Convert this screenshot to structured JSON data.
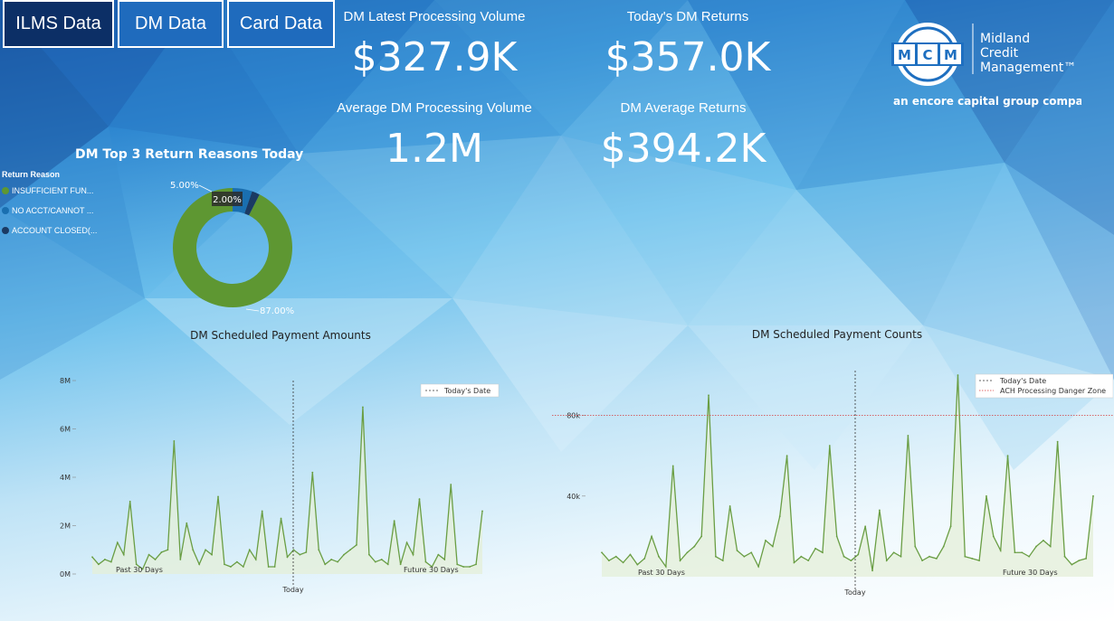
{
  "tabs": [
    {
      "label": "ILMS Data",
      "active": true
    },
    {
      "label": "DM Data",
      "active": false
    },
    {
      "label": "Card Data",
      "active": false
    }
  ],
  "kpis": {
    "latest_volume": {
      "label": "DM Latest Processing Volume",
      "value": "$327.9K"
    },
    "todays_returns": {
      "label": "Today's DM Returns",
      "value": "$357.0K"
    },
    "avg_volume": {
      "label": "Average DM Processing Volume",
      "value": "1.2M"
    },
    "avg_returns": {
      "label": "DM Average Returns",
      "value": "$394.2K"
    }
  },
  "logo": {
    "mark": "MCM",
    "line1": "Midland",
    "line2": "Credit",
    "line3": "Management™",
    "tagline": "an encore capital group company"
  },
  "colors": {
    "insufficient": "#5e9732",
    "no_acct": "#1a6fb0",
    "closed": "#1b3a63",
    "line": "#6a9e44",
    "danger": "#d63a3a"
  },
  "chart_data": [
    {
      "type": "pie",
      "title": "DM Top 3 Return Reasons Today",
      "legend_title": "Return Reason",
      "legend": [
        "INSUFFICIENT FUN...",
        "NO ACCT/CANNOT ...",
        "ACCOUNT CLOSED(..."
      ],
      "values": [
        87.0,
        5.0,
        2.0
      ],
      "labels": [
        "87.00%",
        "5.00%",
        "2.00%"
      ]
    },
    {
      "type": "line",
      "title": "DM Scheduled Payment Amounts",
      "y_ticks": [
        "0M",
        "2M",
        "4M",
        "6M",
        "8M"
      ],
      "ylim": [
        0,
        8
      ],
      "legend": [
        "Today's Date"
      ],
      "x_labels": {
        "past": "Past 30 Days",
        "today": "Today",
        "future": "Future 30 Days"
      },
      "series": [
        {
          "values": [
            0.7,
            0.4,
            0.6,
            0.5,
            1.3,
            0.8,
            3.0,
            0.4,
            0.2,
            0.8,
            0.6,
            0.9,
            1.0,
            5.5,
            0.6,
            2.1,
            1.0,
            0.4,
            1.0,
            0.8,
            3.2,
            0.4,
            0.3,
            0.5,
            0.3,
            1.0,
            0.6,
            2.6,
            0.3,
            0.3,
            2.3,
            0.7,
            1.0,
            0.8,
            0.9,
            4.2,
            1.0,
            0.4,
            0.6,
            0.5,
            0.8,
            1.0,
            1.2,
            6.9,
            0.8,
            0.5,
            0.6,
            0.4,
            2.2,
            0.4,
            1.3,
            0.8,
            3.1,
            0.5,
            0.3,
            0.8,
            0.6,
            3.7,
            0.4,
            0.3,
            0.3,
            0.4,
            2.6
          ]
        }
      ]
    },
    {
      "type": "line",
      "title": "DM Scheduled Payment Counts",
      "y_ticks": [
        "40k",
        "80k"
      ],
      "ylim": [
        0,
        100
      ],
      "legend": [
        "Today's Date",
        "ACH Processing Danger Zone"
      ],
      "danger_level": 80,
      "x_labels": {
        "past": "Past 30 Days",
        "today": "Today",
        "future": "Future 30 Days"
      },
      "series": [
        {
          "values": [
            12,
            8,
            10,
            7,
            11,
            6,
            9,
            20,
            10,
            5,
            55,
            8,
            12,
            15,
            20,
            90,
            10,
            8,
            35,
            13,
            10,
            12,
            5,
            18,
            15,
            30,
            60,
            7,
            10,
            8,
            14,
            12,
            65,
            20,
            10,
            8,
            11,
            25,
            3,
            33,
            8,
            12,
            10,
            70,
            15,
            8,
            10,
            9,
            15,
            25,
            100,
            10,
            9,
            8,
            40,
            20,
            13,
            60,
            12,
            12,
            10,
            15,
            18,
            15,
            67,
            10,
            6,
            8,
            9,
            40
          ]
        }
      ]
    }
  ]
}
